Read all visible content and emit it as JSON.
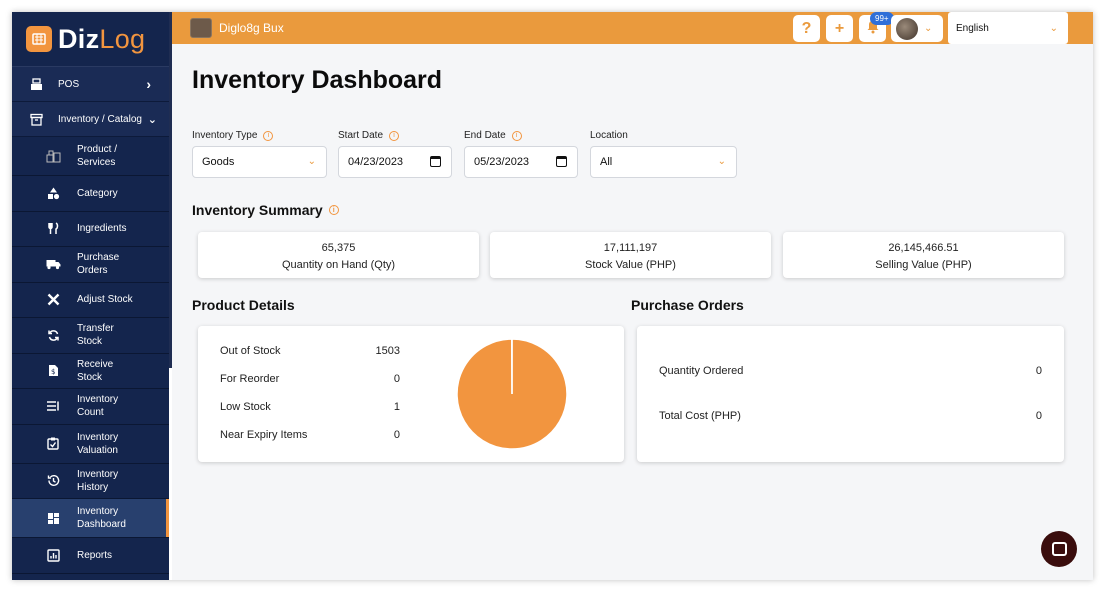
{
  "brand": {
    "name_a": "Diz",
    "name_b": "Log"
  },
  "sidebar": {
    "pos": {
      "label": "POS",
      "icon": "cash-register-icon"
    },
    "section": {
      "label": "Inventory / Catalog",
      "icon": "archive-box-icon"
    },
    "items": [
      {
        "label": "Product / Services",
        "icon": "products-icon"
      },
      {
        "label": "Category",
        "icon": "shapes-icon"
      },
      {
        "label": "Ingredients",
        "icon": "fork-knife-icon"
      },
      {
        "label": "Purchase Orders",
        "icon": "truck-icon"
      },
      {
        "label": "Adjust Stock",
        "icon": "tools-icon"
      },
      {
        "label": "Transfer Stock",
        "icon": "sync-icon"
      },
      {
        "label": "Receive Stock",
        "icon": "dollar-doc-icon"
      },
      {
        "label": "Inventory Count",
        "icon": "list-count-icon"
      },
      {
        "label": "Inventory Valuation",
        "icon": "clipboard-check-icon"
      },
      {
        "label": "Inventory History",
        "icon": "history-icon"
      },
      {
        "label": "Inventory Dashboard",
        "icon": "dashboard-icon"
      },
      {
        "label": "Reports",
        "icon": "report-chart-icon"
      }
    ]
  },
  "header": {
    "store_name": "Diglo8g Bux",
    "help": "?",
    "add": "+",
    "notifications_badge": "99+",
    "language": "English"
  },
  "page": {
    "title": "Inventory Dashboard"
  },
  "filters": {
    "inventory_type": {
      "label": "Inventory Type",
      "value": "Goods"
    },
    "start_date": {
      "label": "Start Date",
      "value": "04/23/2023"
    },
    "end_date": {
      "label": "End Date",
      "value": "05/23/2023"
    },
    "location": {
      "label": "Location",
      "value": "All"
    }
  },
  "summary": {
    "title": "Inventory Summary",
    "cards": [
      {
        "value": "65,375",
        "label": "Quantity on Hand (Qty)"
      },
      {
        "value": "17,111,197",
        "label": "Stock Value (PHP)"
      },
      {
        "value": "26,145,466.51",
        "label": "Selling Value (PHP)"
      }
    ]
  },
  "product_details": {
    "title": "Product Details",
    "rows": [
      {
        "label": "Out of Stock",
        "value": "1503"
      },
      {
        "label": "For Reorder",
        "value": "0"
      },
      {
        "label": "Low Stock",
        "value": "1"
      },
      {
        "label": "Near Expiry Items",
        "value": "0"
      }
    ]
  },
  "purchase_orders": {
    "title": "Purchase Orders",
    "rows": [
      {
        "label": "Quantity Ordered",
        "value": "0"
      },
      {
        "label": "Total Cost (PHP)",
        "value": "0"
      }
    ]
  },
  "chart_data": {
    "type": "pie",
    "categories": [
      "Out of Stock",
      "For Reorder",
      "Low Stock",
      "Near Expiry Items"
    ],
    "values": [
      1503,
      0,
      1,
      0
    ],
    "colors": [
      "#f2953f",
      "#f2953f",
      "#f2953f",
      "#f2953f"
    ],
    "divider_color": "#ffffff"
  },
  "colors": {
    "accent": "#ea9a3d",
    "sidebar": "#14254d",
    "badge": "#2f6fd8"
  }
}
